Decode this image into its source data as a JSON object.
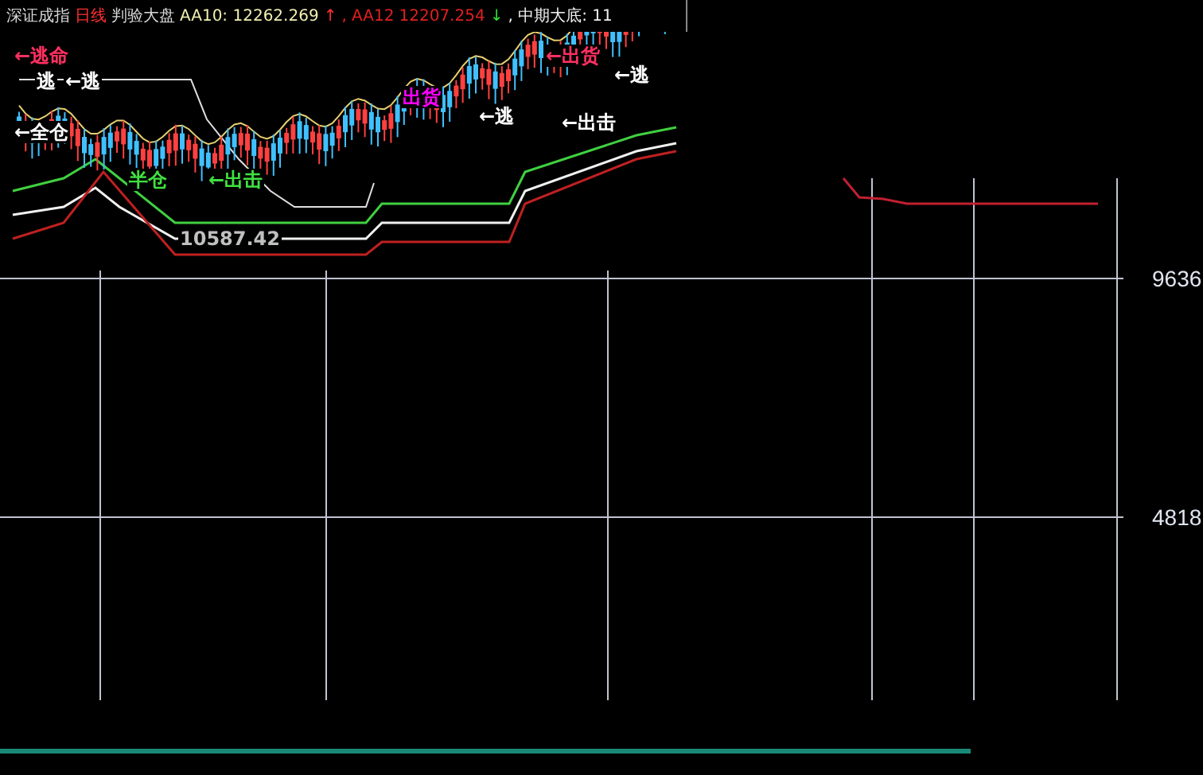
{
  "header": [
    {
      "text": "深证成指",
      "color": "#d8d8d8"
    },
    {
      "text": "日线",
      "color": "#ff3030"
    },
    {
      "text": "判验大盘",
      "color": "#d8d8d8"
    },
    {
      "text": "AA10: 12262.269",
      "color": "#f0f0b0"
    },
    {
      "text": "↑",
      "color": "#ff3030"
    },
    {
      "text": ", AA12",
      "color": "#e02020"
    },
    {
      "text": "12207.254",
      "color": "#e02020"
    },
    {
      "text": "↓",
      "color": "#30e030"
    },
    {
      "text": ", 中期大底: 11",
      "color": "#f0f0f0"
    }
  ],
  "annotations": [
    {
      "text": "←逃命",
      "color": "#ff3060"
    },
    {
      "text": "逃",
      "color": "#ffffff"
    },
    {
      "text": "←逃",
      "color": "#ffffff"
    },
    {
      "text": "←全仓",
      "color": "#ffffff"
    },
    {
      "text": "半仓",
      "color": "#40e040"
    },
    {
      "text": "←出击",
      "color": "#40e040"
    },
    {
      "text": "10587.42",
      "color": "#c0c0c0"
    },
    {
      "text": "出货",
      "color": "#ff00ff"
    },
    {
      "text": "←逃",
      "color": "#ffffff"
    },
    {
      "text": "←出货",
      "color": "#ff3060"
    },
    {
      "text": "←逃",
      "color": "#ffffff"
    },
    {
      "text": "←出击",
      "color": "#ffffff"
    }
  ],
  "axis_labels": [
    "9636",
    "4818"
  ]
}
